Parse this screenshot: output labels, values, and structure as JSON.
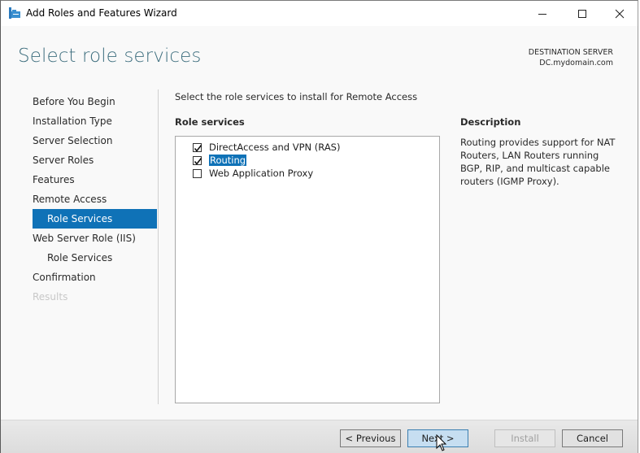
{
  "window": {
    "title": "Add Roles and Features Wizard",
    "controls": [
      "minimize",
      "maximize",
      "close"
    ]
  },
  "header": {
    "title": "Select role services",
    "destination_label": "DESTINATION SERVER",
    "destination_server": "DC.mydomain.com"
  },
  "nav": {
    "items": [
      {
        "label": "Before You Begin",
        "state": "normal"
      },
      {
        "label": "Installation Type",
        "state": "normal"
      },
      {
        "label": "Server Selection",
        "state": "normal"
      },
      {
        "label": "Server Roles",
        "state": "normal"
      },
      {
        "label": "Features",
        "state": "normal"
      },
      {
        "label": "Remote Access",
        "state": "normal"
      },
      {
        "label": "Role Services",
        "state": "active",
        "sub": true
      },
      {
        "label": "Web Server Role (IIS)",
        "state": "normal"
      },
      {
        "label": "Role Services",
        "state": "normal",
        "sub": true
      },
      {
        "label": "Confirmation",
        "state": "normal"
      },
      {
        "label": "Results",
        "state": "disabled"
      }
    ]
  },
  "main": {
    "instruction": "Select the role services to install for Remote Access",
    "role_services_label": "Role services",
    "role_services": [
      {
        "label": "DirectAccess and VPN (RAS)",
        "checked": true,
        "selected": false
      },
      {
        "label": "Routing",
        "checked": true,
        "selected": true
      },
      {
        "label": "Web Application Proxy",
        "checked": false,
        "selected": false
      }
    ],
    "description_label": "Description",
    "description": "Routing provides support for NAT Routers, LAN Routers running BGP, RIP, and multicast capable routers (IGMP Proxy)."
  },
  "footer": {
    "previous_label": "< Previous",
    "next_label": "Next >",
    "install_label": "Install",
    "cancel_label": "Cancel"
  },
  "colors": {
    "accent": "#0f72b7",
    "title": "#3f6f7f"
  }
}
